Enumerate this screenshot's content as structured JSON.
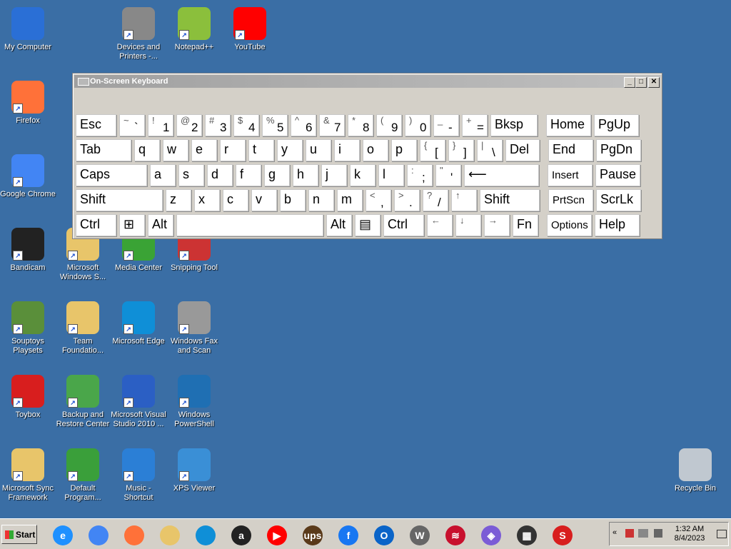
{
  "desktop": {
    "icons": [
      {
        "label": "My Computer",
        "icon": "computer-icon",
        "color": "#2a6fd6"
      },
      {
        "label": "Devices and Printers -...",
        "icon": "printer-icon",
        "color": "#888888"
      },
      {
        "label": "Notepad++",
        "icon": "notepad-plus-icon",
        "color": "#8bbf3c"
      },
      {
        "label": "YouTube",
        "icon": "youtube-icon",
        "color": "#ff0000"
      },
      {
        "label": "Firefox",
        "icon": "firefox-icon",
        "color": "#ff7139"
      },
      {
        "label": "Google Chrome",
        "icon": "chrome-icon",
        "color": "#4285f4"
      },
      {
        "label": "Bandicam",
        "icon": "bandicam-icon",
        "color": "#222222"
      },
      {
        "label": "Microsoft Windows S...",
        "icon": "folder-icon",
        "color": "#e8c56a"
      },
      {
        "label": "Media Center",
        "icon": "media-center-icon",
        "color": "#3aa335"
      },
      {
        "label": "Snipping Tool",
        "icon": "scissors-icon",
        "color": "#c33"
      },
      {
        "label": "Souptoys Playsets",
        "icon": "souptoys-icon",
        "color": "#5a8f3a"
      },
      {
        "label": "Team Foundatio...",
        "icon": "folder-icon",
        "color": "#e8c56a"
      },
      {
        "label": "Microsoft Edge",
        "icon": "edge-icon",
        "color": "#0f8fd7"
      },
      {
        "label": "Windows Fax and Scan",
        "icon": "fax-icon",
        "color": "#999999"
      },
      {
        "label": "Toybox",
        "icon": "toybox-icon",
        "color": "#d81e1e"
      },
      {
        "label": "Backup and Restore Center",
        "icon": "backup-icon",
        "color": "#4aa64a"
      },
      {
        "label": "Microsoft Visual Studio 2010 ...",
        "icon": "help-icon",
        "color": "#2b5fc4"
      },
      {
        "label": "Windows PowerShell",
        "icon": "powershell-icon",
        "color": "#1f6fb3"
      },
      {
        "label": "Microsoft Sync Framework",
        "icon": "sync-framework-icon",
        "color": "#e8c56a"
      },
      {
        "label": "Default Program...",
        "icon": "default-programs-icon",
        "color": "#3a9f3a"
      },
      {
        "label": "Music - Shortcut",
        "icon": "music-icon",
        "color": "#2b7fd6"
      },
      {
        "label": "XPS Viewer",
        "icon": "xps-viewer-icon",
        "color": "#3a8fd6"
      },
      {
        "label": "Recycle Bin",
        "icon": "recycle-bin-icon",
        "color": "#c0c8d0"
      }
    ]
  },
  "osk": {
    "title": "On-Screen Keyboard",
    "min": "_",
    "max": "□",
    "close": "✕",
    "rows": [
      [
        {
          "main": "Esc"
        },
        {
          "sh": "~",
          "lo": "`"
        },
        {
          "sh": "!",
          "lo": "1"
        },
        {
          "sh": "@",
          "lo": "2"
        },
        {
          "sh": "#",
          "lo": "3"
        },
        {
          "sh": "$",
          "lo": "4"
        },
        {
          "sh": "%",
          "lo": "5"
        },
        {
          "sh": "^",
          "lo": "6"
        },
        {
          "sh": "&",
          "lo": "7"
        },
        {
          "sh": "*",
          "lo": "8"
        },
        {
          "sh": "(",
          "lo": "9"
        },
        {
          "sh": ")",
          "lo": "0"
        },
        {
          "sh": "_",
          "lo": "-"
        },
        {
          "sh": "+",
          "lo": "="
        },
        {
          "main": "Bksp"
        },
        {
          "main": "Home"
        },
        {
          "main": "PgUp"
        }
      ],
      [
        {
          "main": "Tab"
        },
        {
          "main": "q"
        },
        {
          "main": "w"
        },
        {
          "main": "e"
        },
        {
          "main": "r"
        },
        {
          "main": "t"
        },
        {
          "main": "y"
        },
        {
          "main": "u"
        },
        {
          "main": "i"
        },
        {
          "main": "o"
        },
        {
          "main": "p"
        },
        {
          "sh": "{",
          "lo": "["
        },
        {
          "sh": "}",
          "lo": "]"
        },
        {
          "sh": "|",
          "lo": "\\"
        },
        {
          "main": "Del"
        },
        {
          "main": "End"
        },
        {
          "main": "PgDn"
        }
      ],
      [
        {
          "main": "Caps"
        },
        {
          "main": "a"
        },
        {
          "main": "s"
        },
        {
          "main": "d"
        },
        {
          "main": "f"
        },
        {
          "main": "g"
        },
        {
          "main": "h"
        },
        {
          "main": "j"
        },
        {
          "main": "k"
        },
        {
          "main": "l"
        },
        {
          "sh": ":",
          "lo": ";"
        },
        {
          "sh": "\"",
          "lo": "'"
        },
        {
          "main": "⟵"
        },
        {
          "main": "Insert"
        },
        {
          "main": "Pause"
        }
      ],
      [
        {
          "main": "Shift"
        },
        {
          "main": "z"
        },
        {
          "main": "x"
        },
        {
          "main": "c"
        },
        {
          "main": "v"
        },
        {
          "main": "b"
        },
        {
          "main": "n"
        },
        {
          "main": "m"
        },
        {
          "sh": "<",
          "lo": ","
        },
        {
          "sh": ">",
          "lo": "."
        },
        {
          "sh": "?",
          "lo": "/"
        },
        {
          "sh": "↑"
        },
        {
          "main": "Shift"
        },
        {
          "main": "PrtScn"
        },
        {
          "main": "ScrLk"
        }
      ],
      [
        {
          "main": "Ctrl"
        },
        {
          "main": "⊞"
        },
        {
          "main": "Alt"
        },
        {
          "main": ""
        },
        {
          "main": "Alt"
        },
        {
          "main": "▤"
        },
        {
          "main": "Ctrl"
        },
        {
          "sh": "←"
        },
        {
          "sh": "↓"
        },
        {
          "sh": "→"
        },
        {
          "main": "Fn"
        },
        {
          "main": "Options"
        },
        {
          "main": "Help"
        }
      ]
    ]
  },
  "taskbar": {
    "start_label": "Start",
    "apps": [
      {
        "name": "internet-explorer",
        "icon": "ie-icon",
        "glyph": "e",
        "color": "#1e90ff"
      },
      {
        "name": "chrome",
        "icon": "chrome-icon",
        "glyph": "",
        "color": "#4285f4"
      },
      {
        "name": "firefox",
        "icon": "firefox-icon",
        "glyph": "",
        "color": "#ff7139"
      },
      {
        "name": "explorer",
        "icon": "folder-icon",
        "glyph": "",
        "color": "#e8c56a"
      },
      {
        "name": "edge",
        "icon": "edge-icon",
        "glyph": "",
        "color": "#0f8fd7"
      },
      {
        "name": "amazon",
        "icon": "amazon-icon",
        "glyph": "a",
        "color": "#222222"
      },
      {
        "name": "youtube",
        "icon": "youtube-icon",
        "glyph": "▶",
        "color": "#ff0000"
      },
      {
        "name": "ups",
        "icon": "ups-icon",
        "glyph": "ups",
        "color": "#5a3a1a"
      },
      {
        "name": "facebook",
        "icon": "facebook-icon",
        "glyph": "f",
        "color": "#1877f2"
      },
      {
        "name": "outlook",
        "icon": "outlook-icon",
        "glyph": "O",
        "color": "#0a64c8"
      },
      {
        "name": "wikipedia",
        "icon": "wikipedia-icon",
        "glyph": "W",
        "color": "#666666"
      },
      {
        "name": "bank-of-america",
        "icon": "bank-icon",
        "glyph": "≋",
        "color": "#c8102e"
      },
      {
        "name": "copilot",
        "icon": "copilot-icon",
        "glyph": "◈",
        "color": "#7b5cd6"
      },
      {
        "name": "store",
        "icon": "store-icon",
        "glyph": "▦",
        "color": "#333333"
      },
      {
        "name": "toybox",
        "icon": "toybox-icon",
        "glyph": "S",
        "color": "#d81e1e"
      }
    ],
    "time": "1:32 AM",
    "date": "8/4/2023"
  }
}
